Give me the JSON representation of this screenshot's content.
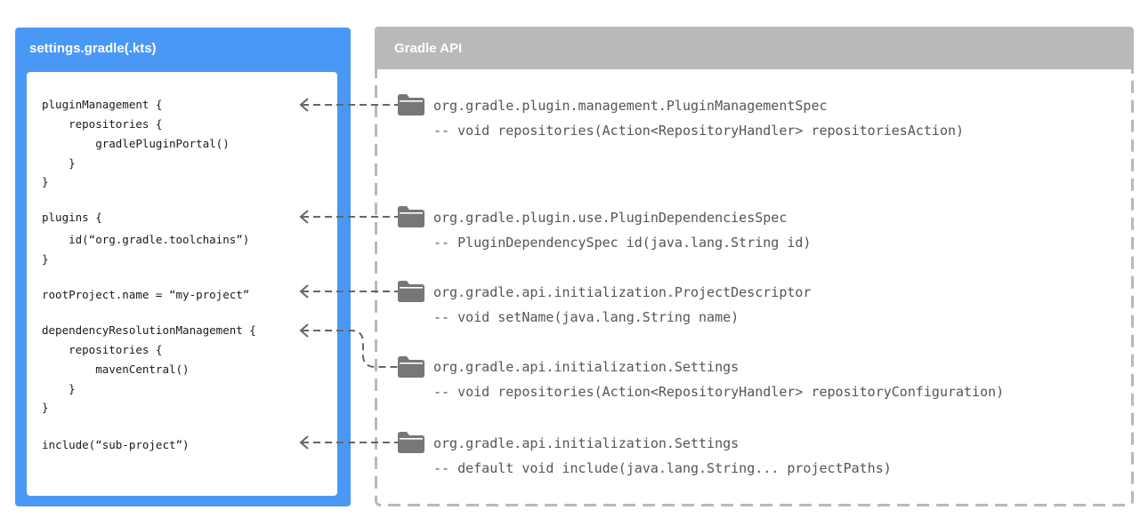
{
  "settings_panel": {
    "title": "settings.gradle(.kts)",
    "code_lines": [
      "pluginManagement {",
      "    repositories {",
      "        gradlePluginPortal()",
      "    }",
      "}",
      "plugins {",
      "    id(“org.gradle.toolchains”)",
      "}",
      "rootProject.name = “my-project”",
      "dependencyResolutionManagement {",
      "    repositories {",
      "        mavenCentral()",
      "    }",
      "}",
      "include(“sub-project”)"
    ]
  },
  "api_panel": {
    "title": "Gradle API",
    "entries": [
      {
        "type": "org.gradle.plugin.management.PluginManagementSpec",
        "method": "-- void repositories(Action<RepositoryHandler> repositoriesAction)"
      },
      {
        "type": "org.gradle.plugin.use.PluginDependenciesSpec",
        "method": "-- PluginDependencySpec id(java.lang.String id)"
      },
      {
        "type": "org.gradle.api.initialization.ProjectDescriptor",
        "method": "-- void setName(java.lang.String name)"
      },
      {
        "type": "org.gradle.api.initialization.Settings",
        "method": "-- void repositories(Action<RepositoryHandler> repositoryConfiguration)"
      },
      {
        "type": "org.gradle.api.initialization.Settings",
        "method": "-- default void include(java.lang.String... projectPaths)"
      }
    ],
    "entry_icon": "folder-icon"
  },
  "colors": {
    "settings_accent": "#4a98f6",
    "api_accent": "#b9b9b9",
    "connector": "#666666",
    "api_text": "#555555"
  }
}
